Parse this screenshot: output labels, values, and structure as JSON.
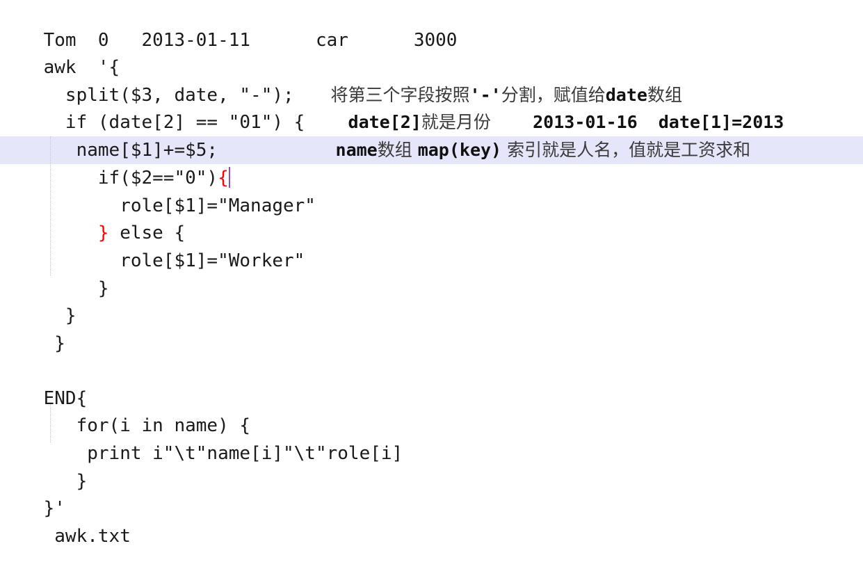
{
  "editor": {
    "kind": "code-editor-screenshot",
    "language": "awk",
    "background_color": "#ffffff",
    "text_color": "#1a1a1a",
    "current_line_highlight_color": "#e6e6fa",
    "brace_match_color": "#ff0000",
    "caret_color": "#8a4fd0",
    "indent_guide_color": "#c8c8c8",
    "annotation_color": "#3a3a3a",
    "current_line_number": 6,
    "total_lines": 19
  },
  "lines": [
    {
      "n": 1,
      "text": "Tom  0   2013-01-11      car      3000"
    },
    {
      "n": 2,
      "text": "awk  '{"
    },
    {
      "n": 3,
      "text": "  split($3, date, \"-\");"
    },
    {
      "n": 4,
      "text": "  if (date[2] == \"01\") {"
    },
    {
      "n": 5,
      "text": "   name[$1]+=$5;"
    },
    {
      "n": 6,
      "text": "     if($2==\"0\")",
      "brace": "{",
      "caret": true,
      "highlighted": true
    },
    {
      "n": 7,
      "text": "       role[$1]=\"Manager\""
    },
    {
      "n": 8,
      "text": "     ",
      "brace_close": "}",
      "rest": " else {"
    },
    {
      "n": 9,
      "text": "       role[$1]=\"Worker\""
    },
    {
      "n": 10,
      "text": "     }"
    },
    {
      "n": 11,
      "text": "  }"
    },
    {
      "n": 12,
      "text": " }"
    },
    {
      "n": 13,
      "text": ""
    },
    {
      "n": 14,
      "text": "END{"
    },
    {
      "n": 15,
      "text": "   for(i in name) {"
    },
    {
      "n": 16,
      "text": "    print i\"\\t\"name[i]\"\\t\"role[i]"
    },
    {
      "n": 17,
      "text": "   }"
    },
    {
      "n": 18,
      "text": "}'"
    },
    {
      "n": 19,
      "text": " awk.txt"
    }
  ],
  "annotations": [
    {
      "id": "split-comment",
      "line": 3,
      "segments": [
        {
          "type": "cn",
          "text": "将第三个字段按照"
        },
        {
          "type": "mono",
          "text": "'-'"
        },
        {
          "type": "cn",
          "text": "分割，赋值给"
        },
        {
          "type": "mono",
          "text": "date"
        },
        {
          "type": "cn",
          "text": "数组"
        }
      ],
      "plain": "将第三个字段按照'-'分割，赋值给date数组"
    },
    {
      "id": "month-comment",
      "line": 4,
      "segments": [
        {
          "type": "mono",
          "text": "date[2]"
        },
        {
          "type": "cn",
          "text": "就是月份"
        },
        {
          "type": "mono",
          "text": "    2013-01-16  date[1]=2013"
        }
      ],
      "plain": "date[2]就是月份    2013-01-16  date[1]=2013"
    },
    {
      "id": "name-array-comment",
      "line": 5,
      "segments": [
        {
          "type": "mono",
          "text": "name"
        },
        {
          "type": "cn",
          "text": "数组 "
        },
        {
          "type": "mono",
          "text": "map(key)"
        },
        {
          "type": "cn",
          "text": " 索引就是人名，值就是工资求和"
        }
      ],
      "plain": "name数组 map(key) 索引就是人名，值就是工资求和"
    }
  ]
}
